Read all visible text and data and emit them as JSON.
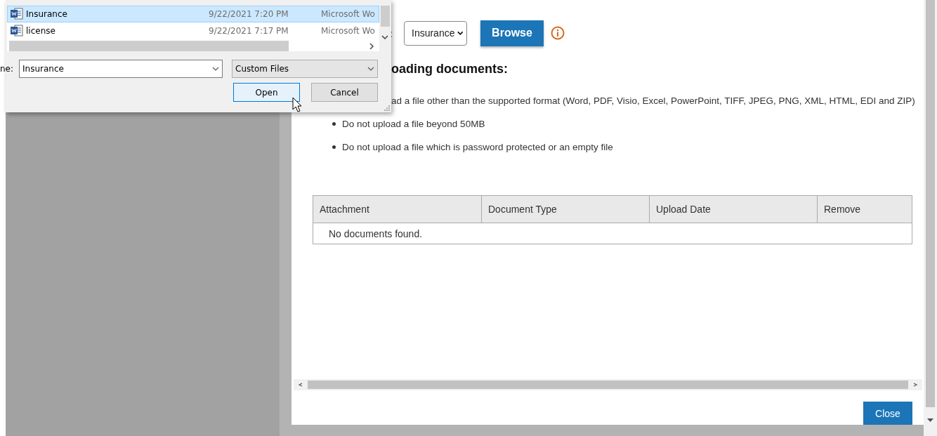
{
  "file_dialog": {
    "files": [
      {
        "name": "Insurance",
        "date": "9/22/2021 7:20 PM",
        "type": "Microsoft Wo",
        "selected": true
      },
      {
        "name": "license",
        "date": "9/22/2021 7:17 PM",
        "type": "Microsoft Wo",
        "selected": false
      }
    ],
    "file_name_label": "ne:",
    "file_name": "Insurance",
    "filter": "Custom Files",
    "buttons": [
      {
        "label": "Open",
        "focused": true
      },
      {
        "label": "Cancel",
        "focused": false
      }
    ]
  },
  "upload_modal": {
    "type_label": ":",
    "type_value": "Insurance",
    "browse": "Browse",
    "heading": "oading documents:",
    "rules": [
      {
        "text": "ad a file other than the supported format (Word, PDF, Visio, Excel, PowerPoint, TIFF, JPEG, PNG, XML, HTML, EDI and ZIP)",
        "cut": true
      },
      {
        "text": "Do not upload a file beyond 50MB",
        "cut": false
      },
      {
        "text": "Do not upload a file which is password protected or an empty file",
        "cut": false
      }
    ],
    "table": {
      "columns": [
        "Attachment",
        "Document Type",
        "Upload Date",
        "Remove"
      ],
      "empty_message": "No documents found."
    },
    "close": "Close"
  }
}
